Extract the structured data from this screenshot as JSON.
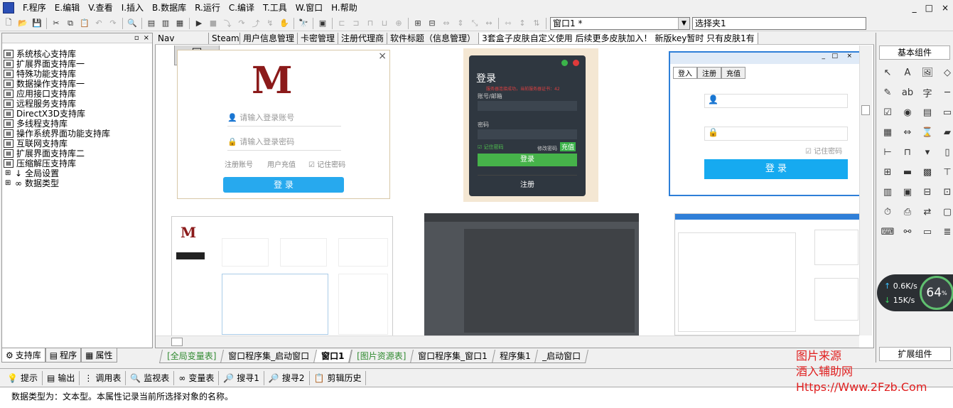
{
  "menu": [
    "F.程序",
    "E.编辑",
    "V.查看",
    "I.插入",
    "B.数据库",
    "R.运行",
    "C.编译",
    "T.工具",
    "W.窗口",
    "H.帮助"
  ],
  "window_buttons": [
    "_",
    "□",
    "×"
  ],
  "toolbar": {
    "combo_window": "窗口1 *",
    "combo_clip": "选择夹1"
  },
  "tree": [
    {
      "label": "系统核心支持库"
    },
    {
      "label": "扩展界面支持库一"
    },
    {
      "label": "特殊功能支持库"
    },
    {
      "label": "数据操作支持库一"
    },
    {
      "label": "应用接口支持库"
    },
    {
      "label": "远程服务支持库"
    },
    {
      "label": "DirectX3D支持库"
    },
    {
      "label": "多线程支持库"
    },
    {
      "label": "操作系统界面功能支持库"
    },
    {
      "label": "互联网支持库"
    },
    {
      "label": "扩展界面支持库二"
    },
    {
      "label": "压缩解压支持库"
    },
    {
      "label": "全局设置"
    },
    {
      "label": "数据类型"
    }
  ],
  "left_tabs": [
    "支持库",
    "程序",
    "属性"
  ],
  "doc_tabs": [
    "Nav",
    "Steam",
    "用户信息管理",
    "卡密管理",
    "注册代理商",
    "软件标题（信息管理）",
    "3套盒子皮肤自定义使用 后续更多皮肤加入！ 新版key暂时 只有皮肤1有"
  ],
  "bottom_tabs": [
    "[全局变量表]",
    "窗口程序集_启动窗口",
    "窗口1",
    "[图片资源表]",
    "窗口程序集_窗口1",
    "程序集1",
    "_启动窗口"
  ],
  "palette_title": "基本组件",
  "palette_bottom": "扩展组件",
  "output_tabs": [
    "提示",
    "输出",
    "调用表",
    "监视表",
    "变量表",
    "搜寻1",
    "搜寻2",
    "剪辑历史"
  ],
  "status_text": "数据类型为：文本型。本属性记录当前所选择对象的名称。",
  "watermark": [
    "图片来源",
    "酒入辅助网",
    "Https://Www.2Fzb.Com"
  ],
  "speed": {
    "up": "0.6K/s",
    "down": "15K/s",
    "percent": "64"
  },
  "skin1": {
    "user_ph": "请输入登录账号",
    "pass_ph": "请输入登录密码",
    "register": "注册账号",
    "recharge": "用户充值",
    "remember": "记住密码",
    "login": "登  录"
  },
  "skin2": {
    "title": "登录",
    "notice": "服务器连接成功，当前服务器证书：42",
    "account": "账号/邮箱",
    "password": "密码",
    "remember": "记住密码",
    "modify": "修改密码",
    "recharge": "充值",
    "login": "登录",
    "register": "注册"
  },
  "skin3": {
    "tabs": [
      "登入",
      "注册",
      "充值"
    ],
    "remember": "记住密码",
    "login": "登  录"
  }
}
